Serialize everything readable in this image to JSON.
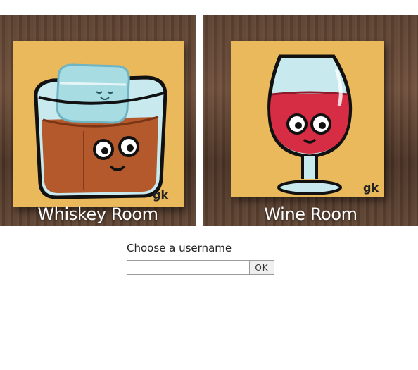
{
  "rooms": [
    {
      "label": "Whiskey Room",
      "signature": "gk"
    },
    {
      "label": "Wine Room",
      "signature": "gk"
    }
  ],
  "login": {
    "prompt": "Choose a username",
    "username_value": "",
    "username_placeholder": "",
    "ok_label": "OK"
  },
  "colors": {
    "canvas_yellow": "#e9b95c",
    "whiskey_brown": "#b3592c",
    "ice_blue": "#a8dce3",
    "wine_red": "#d62d45",
    "wood": "#5b4030"
  }
}
